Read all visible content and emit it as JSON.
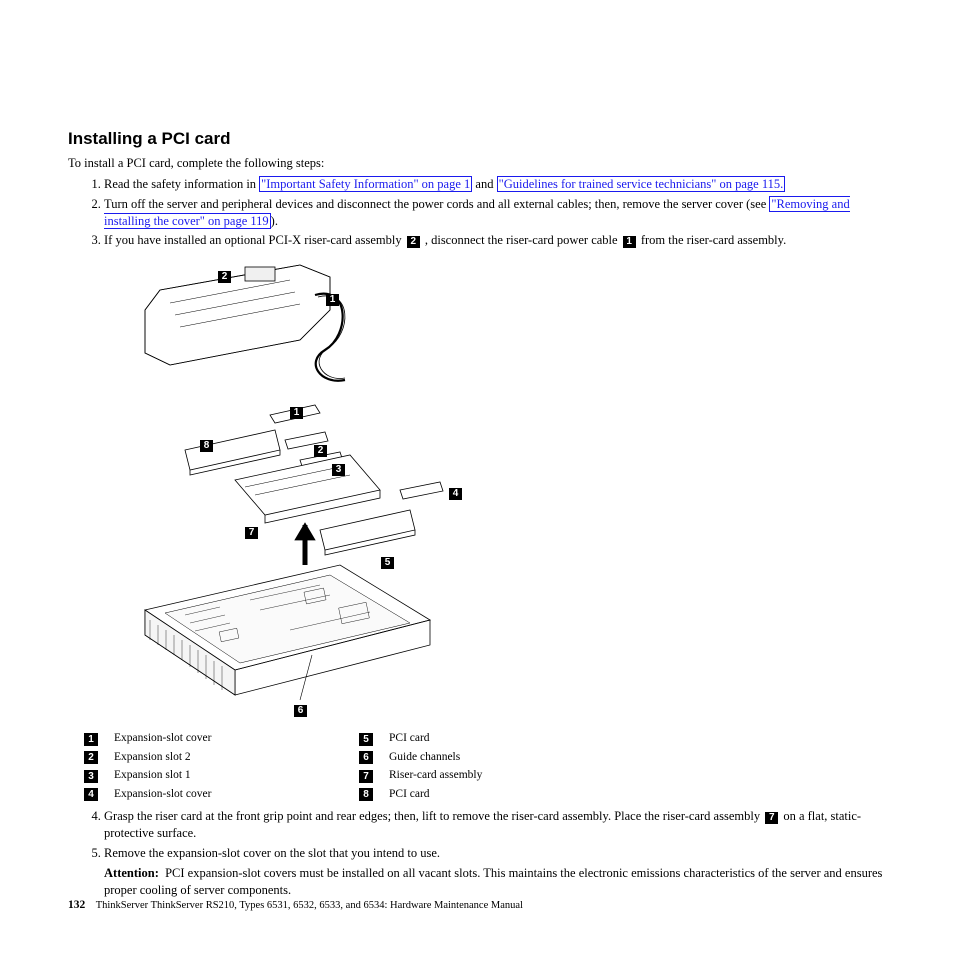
{
  "heading": "Installing a PCI card",
  "intro": "To install a PCI card, complete the following steps:",
  "steps": {
    "s1_a": "Read the safety information in ",
    "s1_link1": "\"Important Safety Information\" on page 1",
    "s1_b": " and ",
    "s1_link2": "\"Guidelines for trained service technicians\" on page 115.",
    "s2_a": "Turn off the server and peripheral devices and disconnect the power cords and all external cables; then, remove the server cover (see ",
    "s2_link1": "\"Removing and installing the cover\" on page 119",
    "s2_b": ").",
    "s3_a": "If you have installed an optional PCI-X riser-card assembly ",
    "s3_b": " , disconnect the riser-card power cable ",
    "s3_c": " from the riser-card assembly.",
    "s4_a": "Grasp the riser card at the front grip point and rear edges; then, lift to remove the riser-card assembly. Place the riser-card assembly ",
    "s4_b": " on a flat, static-protective surface.",
    "s5": "Remove the expansion-slot cover on the slot that you intend to use.",
    "attention_label": "Attention:",
    "attention_text": "PCI expansion-slot covers must be installed on all vacant slots. This maintains the electronic emissions characteristics of the server and ensures proper cooling of server components."
  },
  "inline_callouts": {
    "c2": "2",
    "c1": "1",
    "c7": "7"
  },
  "legend": {
    "l1": "Expansion-slot cover",
    "l2": "Expansion slot 2",
    "l3": "Expansion slot 1",
    "l4": "Expansion-slot cover",
    "l5": "PCI card",
    "l6": "Guide channels",
    "l7": "Riser-card assembly",
    "l8": "PCI card"
  },
  "legend_nums": {
    "n1": "1",
    "n2": "2",
    "n3": "3",
    "n4": "4",
    "n5": "5",
    "n6": "6",
    "n7": "7",
    "n8": "8"
  },
  "fig_callouts": {
    "f1": "1",
    "f2": "2",
    "f3": "3",
    "f4": "4",
    "f5": "5",
    "f6": "6",
    "f7": "7",
    "f8": "8"
  },
  "footer": {
    "pagenum": "132",
    "text": "ThinkServer ThinkServer RS210, Types 6531, 6532, 6533, and 6534: Hardware Maintenance Manual"
  }
}
